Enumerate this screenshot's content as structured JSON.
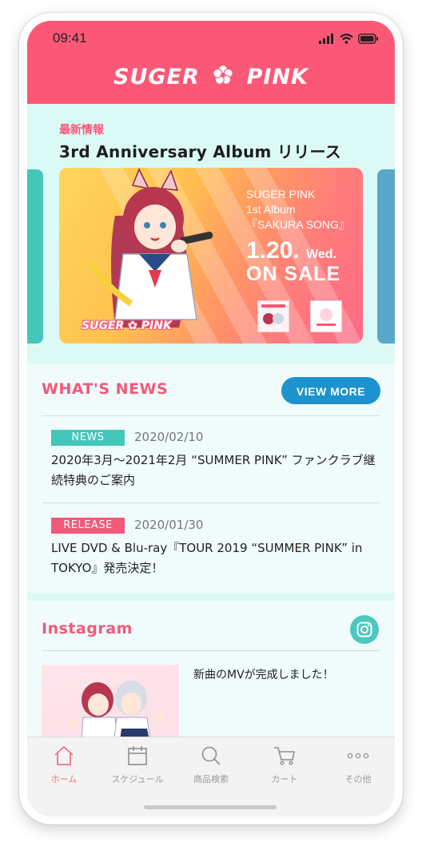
{
  "status_bar": {
    "time": "09:41"
  },
  "header": {
    "logo_left": "SUGER",
    "logo_right": "PINK"
  },
  "hero": {
    "label": "最新情報",
    "title": "3rd Anniversary Album リリース",
    "banner": {
      "line1": "SUGER PINK",
      "line2": "1st Album",
      "line3": "『SAKURA SONG』",
      "date": "1.20.",
      "weekday": "Wed.",
      "onsale": "ON SALE",
      "logo": "SUGER ✿ PINK"
    }
  },
  "news": {
    "title": "WHAT'S NEWS",
    "view_more": "VIEW MORE",
    "items": [
      {
        "badge": "NEWS",
        "badge_color": "#43c7bb",
        "date": "2020/02/10",
        "text": "2020年3月～2021年2月 “SUMMER PINK” ファンクラブ継続特典のご案内"
      },
      {
        "badge": "RELEASE",
        "badge_color": "#f2597a",
        "date": "2020/01/30",
        "text": "LIVE DVD & Blu-ray『TOUR 2019 “SUMMER PINK” in TOKYO』発売決定！"
      }
    ]
  },
  "instagram": {
    "title": "Instagram",
    "icon": "instagram-icon",
    "caption": "新曲のMVが完成しました！"
  },
  "tabbar": {
    "items": [
      {
        "label": "ホーム",
        "icon": "home-icon",
        "active": true
      },
      {
        "label": "スケジュール",
        "icon": "calendar-icon",
        "active": false
      },
      {
        "label": "商品検索",
        "icon": "search-icon",
        "active": false
      },
      {
        "label": "カート",
        "icon": "cart-icon",
        "active": false
      },
      {
        "label": "その他",
        "icon": "more-icon",
        "active": false
      }
    ]
  },
  "colors": {
    "brand_pink": "#fb5877",
    "mint": "#dcfaf5",
    "accent_blue": "#1c93ce",
    "teal": "#43c7bb"
  }
}
